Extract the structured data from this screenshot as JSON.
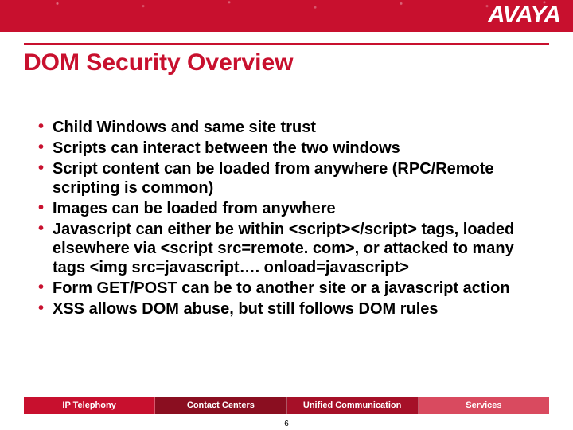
{
  "brand": {
    "logo_text": "AVAYA"
  },
  "colors": {
    "accent": "#c8102e"
  },
  "title": "DOM Security Overview",
  "bullets": [
    "Child Windows and same site trust",
    "Scripts can interact between the two windows",
    "Script content can be loaded from anywhere (RPC/Remote scripting is common)",
    "Images can be loaded from anywhere",
    "Javascript can either be within <script></script> tags, loaded elsewhere via <script src=remote. com>, or attacked to many tags <img src=javascript…. onload=javascript>",
    "Form GET/POST can be to another site or a javascript action",
    "XSS allows DOM abuse, but still follows DOM rules"
  ],
  "footer": {
    "segments": [
      "IP Telephony",
      "Contact Centers",
      "Unified Communication",
      "Services"
    ]
  },
  "slide_number": "6"
}
